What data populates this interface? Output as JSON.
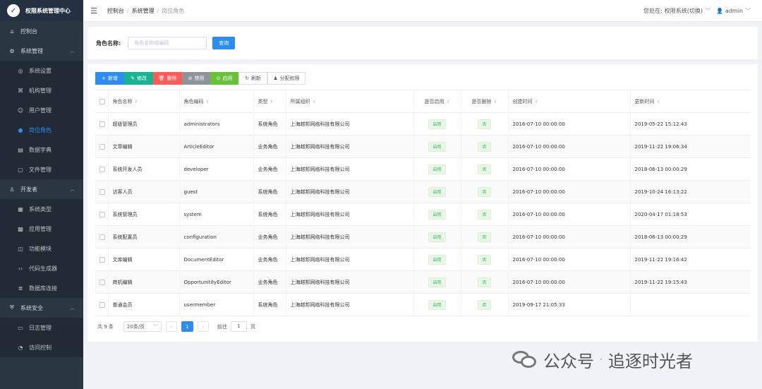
{
  "app": {
    "title": "权限系统管理中心"
  },
  "sidebar": {
    "dashboard": "控制台",
    "groups": [
      {
        "label": "系统管理",
        "icon": "gear-icon",
        "items": [
          {
            "label": "系统设置",
            "icon": "settings-icon",
            "active": false
          },
          {
            "label": "机构管理",
            "icon": "org-icon",
            "active": false
          },
          {
            "label": "用户管理",
            "icon": "user-icon",
            "active": false
          },
          {
            "label": "岗位角色",
            "icon": "role-icon",
            "active": true
          },
          {
            "label": "数据字典",
            "icon": "book-icon",
            "active": false
          },
          {
            "label": "文件管理",
            "icon": "file-icon",
            "active": false
          }
        ]
      },
      {
        "label": "开发者",
        "icon": "developer-icon",
        "items": [
          {
            "label": "系统类型",
            "icon": "calendar-icon",
            "active": false
          },
          {
            "label": "应用管理",
            "icon": "apps-icon",
            "active": false
          },
          {
            "label": "功能模块",
            "icon": "module-icon",
            "active": false
          },
          {
            "label": "代码生成器",
            "icon": "code-icon",
            "active": false
          },
          {
            "label": "数据库连接",
            "icon": "database-icon",
            "active": false
          }
        ]
      },
      {
        "label": "系统安全",
        "icon": "shield-icon",
        "items": [
          {
            "label": "日志管理",
            "icon": "log-icon",
            "active": false
          },
          {
            "label": "访问控制",
            "icon": "access-icon",
            "active": false
          }
        ]
      }
    ]
  },
  "header": {
    "breadcrumb": [
      "控制台",
      "系统管理",
      "岗位角色"
    ],
    "location_label": "您处在:",
    "system": "权限系统(切换)",
    "user": "admin"
  },
  "search": {
    "label": "角色名称:",
    "placeholder": "角色名称或编码",
    "button": "查询"
  },
  "toolbar": {
    "add": "新增",
    "edit": "修改",
    "delete": "删除",
    "disable": "禁用",
    "enable": "启用",
    "refresh": "刷新",
    "assign": "分配权限"
  },
  "table": {
    "headers": [
      "角色名称",
      "角色编码",
      "类型",
      "所属组织",
      "是否启用",
      "是否删除",
      "创建时间",
      "更新时间"
    ],
    "rows": [
      {
        "name": "超级管理员",
        "code": "administrators",
        "type": "系统角色",
        "org": "上海越邦网络科技有限公司",
        "enabled": "启用",
        "deleted": "否",
        "created": "2016-07-10 00:00:00",
        "updated": "2019-05-22 15:12:43"
      },
      {
        "name": "文章编辑",
        "code": "ArticleEditor",
        "type": "业务角色",
        "org": "上海越邦网络科技有限公司",
        "enabled": "启用",
        "deleted": "否",
        "created": "2016-07-10 00:00:00",
        "updated": "2019-11-22 19:06:34"
      },
      {
        "name": "系统开发人员",
        "code": "developer",
        "type": "业务角色",
        "org": "上海越邦网络科技有限公司",
        "enabled": "启用",
        "deleted": "否",
        "created": "2016-07-10 00:00:00",
        "updated": "2018-06-13 00:00:29"
      },
      {
        "name": "访客人员",
        "code": "guest",
        "type": "系统角色",
        "org": "上海越邦网络科技有限公司",
        "enabled": "启用",
        "deleted": "否",
        "created": "2016-07-10 00:00:00",
        "updated": "2019-10-24 16:13:22"
      },
      {
        "name": "系统管理员",
        "code": "system",
        "type": "系统角色",
        "org": "上海越邦网络科技有限公司",
        "enabled": "启用",
        "deleted": "否",
        "created": "2016-07-10 00:00:00",
        "updated": "2020-04-17 01:18:53"
      },
      {
        "name": "系统配置员",
        "code": "configuration",
        "type": "业务角色",
        "org": "上海越邦网络科技有限公司",
        "enabled": "启用",
        "deleted": "否",
        "created": "2016-07-10 00:00:00",
        "updated": "2018-06-13 00:00:29"
      },
      {
        "name": "文库编辑",
        "code": "DocumentEditor",
        "type": "业务角色",
        "org": "上海越邦网络科技有限公司",
        "enabled": "启用",
        "deleted": "否",
        "created": "2016-07-10 00:00:00",
        "updated": "2019-11-22 19:16:42"
      },
      {
        "name": "商机编辑",
        "code": "OpportunitityEditor",
        "type": "业务角色",
        "org": "上海越邦网络科技有限公司",
        "enabled": "启用",
        "deleted": "否",
        "created": "2016-07-10 00:00:00",
        "updated": "2019-11-22 19:15:43"
      },
      {
        "name": "普通会员",
        "code": "usermember",
        "type": "系统角色",
        "org": "上海越邦网络科技有限公司",
        "enabled": "启用",
        "deleted": "否",
        "created": "2019-09-17 21:05:33",
        "updated": ""
      }
    ]
  },
  "pagination": {
    "total": "共 9 条",
    "page_size": "20条/页",
    "current": "1",
    "goto_label": "前往",
    "goto_value": "1",
    "page_suffix": "页"
  },
  "watermark": {
    "text": "公众号",
    "dot": "·",
    "author": "追逐时光者"
  },
  "colors": {
    "sidebar_bg": "#2b3643",
    "primary": "#2d8cf0",
    "success": "#19be6b",
    "danger": "#ff5b57"
  }
}
